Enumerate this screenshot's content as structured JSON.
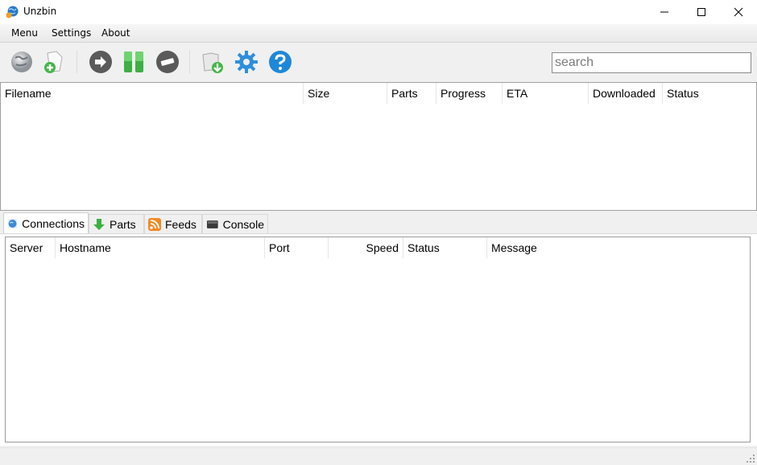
{
  "window": {
    "title": "Unzbin",
    "controls": {
      "minimize": "—",
      "maximize": "☐",
      "close": "✕"
    }
  },
  "menu": {
    "items": [
      "Menu",
      "Settings",
      "About"
    ]
  },
  "toolbar": {
    "buttons": [
      {
        "name": "connect-servers",
        "icon": "globe-icon"
      },
      {
        "name": "add-nzb",
        "icon": "add-file-icon"
      },
      {
        "name": "resume",
        "icon": "play-icon"
      },
      {
        "name": "pause",
        "icon": "pause-icon"
      },
      {
        "name": "stop",
        "icon": "stop-icon"
      },
      {
        "name": "open-downloads",
        "icon": "folder-download-icon"
      },
      {
        "name": "settings",
        "icon": "gear-icon"
      },
      {
        "name": "help",
        "icon": "help-icon"
      }
    ],
    "search": {
      "placeholder": "search",
      "value": ""
    }
  },
  "downloads": {
    "columns": [
      "Filename",
      "Size",
      "Parts",
      "Progress",
      "ETA",
      "Downloaded",
      "Status"
    ],
    "rows": []
  },
  "tabs": [
    {
      "label": "Connections",
      "icon": "globe-icon",
      "active": true
    },
    {
      "label": "Parts",
      "icon": "green-down-arrow-icon",
      "active": false
    },
    {
      "label": "Feeds",
      "icon": "rss-icon",
      "active": false
    },
    {
      "label": "Console",
      "icon": "console-icon",
      "active": false
    }
  ],
  "connections": {
    "columns": [
      "Server",
      "Hostname",
      "Port",
      "Speed",
      "Status",
      "Message"
    ],
    "rows": []
  },
  "colors": {
    "accent_blue": "#1e88d8",
    "pause_green": "#3cb043",
    "rss_orange": "#f08a24"
  }
}
